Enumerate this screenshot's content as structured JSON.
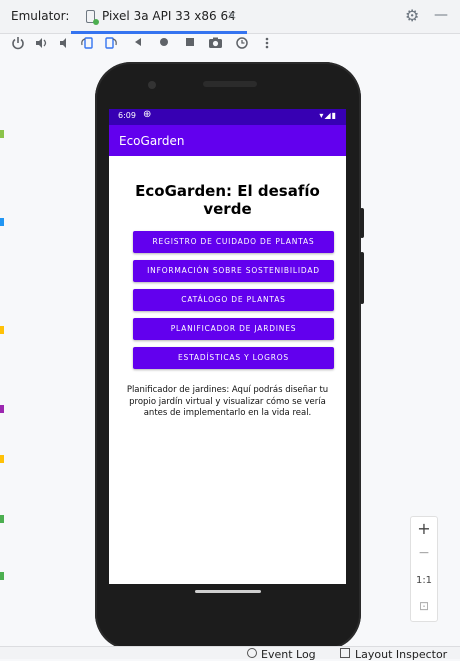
{
  "ide": {
    "tool_window_label": "Emulator:",
    "tab_title": "Pixel 3a API 33 x86 64",
    "tab_close": "×",
    "settings_icon": "⚙",
    "minimize_icon": "—"
  },
  "emulator_toolbar": {
    "icons": [
      "power-icon",
      "volume-up-icon",
      "volume-down-icon",
      "rotate-left-icon",
      "rotate-right-icon",
      "back-icon",
      "home-icon",
      "overview-icon",
      "screenshot-icon",
      "snapshot-icon",
      "more-icon"
    ]
  },
  "device": {
    "status_time": "6:09",
    "status_settings_icon": "⊕",
    "status_signal": "▾◢▮",
    "app_title": "EcoGarden",
    "heading": "EcoGarden: El desafío verde",
    "buttons": [
      "REGISTRO DE CUIDADO DE PLANTAS",
      "INFORMACIÓN SOBRE SOSTENIBILIDAD",
      "CATÁLOGO DE PLANTAS",
      "PLANIFICADOR DE JARDINES",
      "ESTADÍSTICAS Y LOGROS"
    ],
    "description": "Planificador de jardines: Aquí podrás diseñar tu propio jardín virtual y visualizar cómo se vería antes de implementarlo en la vida real."
  },
  "zoom": {
    "plus": "+",
    "minus": "−",
    "one_to_one": "1:1",
    "fit": "⊡"
  },
  "bottom": {
    "event_log": "Event Log",
    "layout_inspector": "Layout Inspector"
  },
  "colors": {
    "status_bar": "#3700b3",
    "app_bar": "#6200ee",
    "button": "#6200ee",
    "tab_underline": "#3574f0"
  }
}
